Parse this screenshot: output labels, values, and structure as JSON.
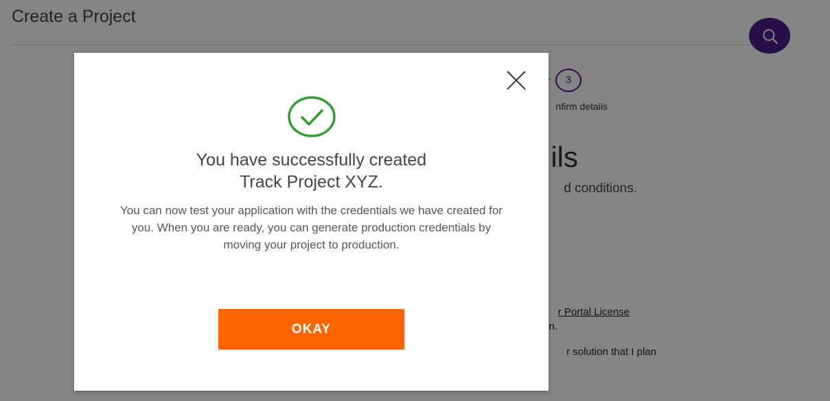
{
  "page": {
    "title": "Create a Project",
    "step_number": "3",
    "step_label_fragment": "nfirm details",
    "heading_fragment": "ils",
    "subheading_fragment": "d conditions.",
    "license_link_fragment": "r Portal License",
    "license_text_fragment": "n.",
    "solution_text_fragment": "r solution that I plan"
  },
  "header": {
    "search_icon": "search-icon"
  },
  "modal": {
    "icon": "check-circle-icon",
    "title_line1": "You have successfully created",
    "title_line2": "Track Project XYZ.",
    "body": "You can now test your application with the credentials we have created for you. When you are ready, you can generate production credentials by moving your project to production.",
    "okay_label": "OKAY",
    "close_icon": "close-icon"
  },
  "colors": {
    "accent_purple": "#4b1e8c",
    "success_green": "#2e9e2e",
    "button_orange": "#ff6600",
    "overlay": "rgba(0,0,0,0.48)"
  }
}
